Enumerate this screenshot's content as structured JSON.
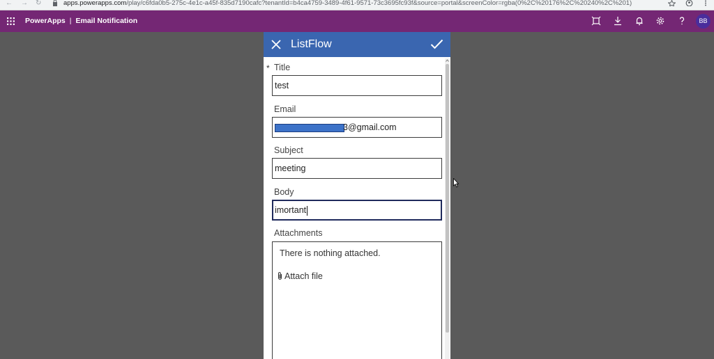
{
  "browser": {
    "url_host": "apps.powerapps.com",
    "url_path": "/play/c6fda0b5-275c-4e1c-a45f-835d7190cafc?tenantId=b4ca4759-3489-4f61-9571-73c3695fc93f&source=portal&screenColor=rgba(0%2C%20176%2C%20240%2C%201)"
  },
  "header": {
    "app_name": "PowerApps",
    "separator": "|",
    "screen_name": "Email Notification",
    "avatar_initials": "BB",
    "brand_color": "#742774"
  },
  "form": {
    "title": "ListFlow",
    "required_marker": "*",
    "fields": {
      "title": {
        "label": "Title",
        "value": "test"
      },
      "email": {
        "label": "Email",
        "value": "3@gmail.com"
      },
      "subject": {
        "label": "Subject",
        "value": "meeting"
      },
      "body": {
        "label": "Body",
        "value": "imortant"
      }
    },
    "attachments": {
      "label": "Attachments",
      "empty_text": "There is nothing attached.",
      "attach_label": "Attach file"
    },
    "header_color": "#3a66b0"
  }
}
